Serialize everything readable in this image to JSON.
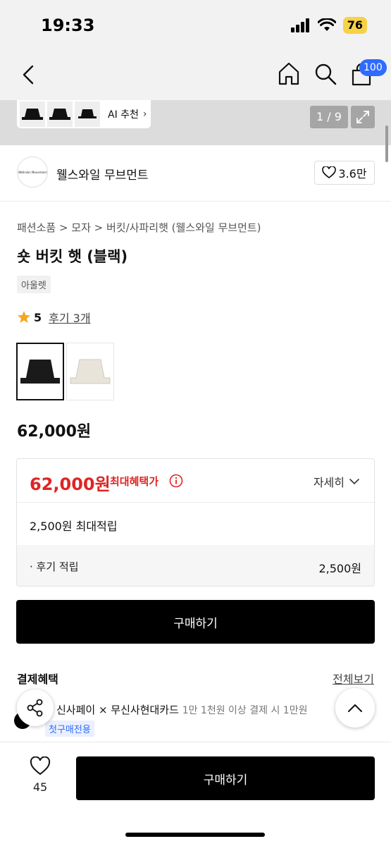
{
  "status_bar": {
    "time": "19:33",
    "battery": "76"
  },
  "nav": {
    "cart_count": "100",
    "icons": {
      "back": "chevron-left-icon",
      "home": "home-icon",
      "search": "search-icon",
      "cart": "shopping-bag-icon"
    }
  },
  "gallery": {
    "ai_label": "AI 추천",
    "page_indicator": "1 / 9"
  },
  "brand": {
    "logo_text": "Wellnskn Movement",
    "name": "웰스와일 무브먼트",
    "likes": "3.6만"
  },
  "product": {
    "breadcrumb": "패션소품 > 모자 > 버킷/사파리햇 (웰스와일 무브먼트)",
    "title": "숏 버킷 햇 (블랙)",
    "tag": "아울렛",
    "rating": "5",
    "review_link": "후기 3개",
    "price": "62,000원",
    "colors": [
      {
        "name": "black",
        "hex": "#1a1a1a",
        "selected": true
      },
      {
        "name": "ivory",
        "hex": "#e8e4da",
        "selected": false
      }
    ]
  },
  "benefit": {
    "price": "62,000원",
    "label": "최대혜택가",
    "detail": "자세히",
    "points_line": "2,500원 최대적립",
    "review_points_label": "· 후기 적립",
    "review_points_value": "2,500원"
  },
  "buy_button": "구매하기",
  "payment": {
    "title": "결제혜택",
    "view_all": "전체보기",
    "line_main": "신사페이 × 무신사현대카드",
    "line_sub": "1만 1천원 이상 결제 시 1만원",
    "tag": "첫구매전용"
  },
  "bottom_bar": {
    "like_count": "45",
    "buy": "구매하기"
  },
  "colors": {
    "accent_red": "#e02424",
    "badge_blue": "#2f6bff",
    "battery_yellow": "#f7d247"
  }
}
